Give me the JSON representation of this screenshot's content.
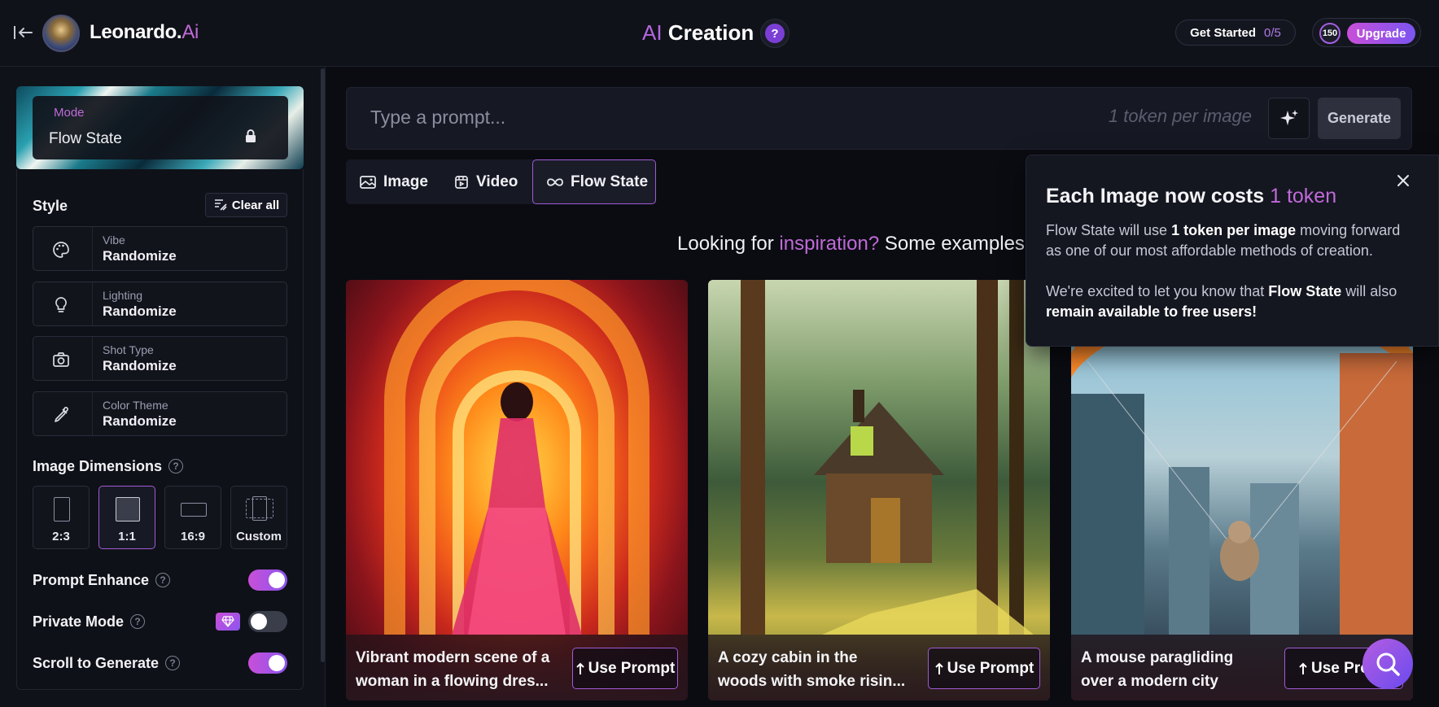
{
  "header": {
    "logo_main": "Leonardo.",
    "logo_accent": "Ai",
    "title_accent": "AI",
    "title_main": "Creation",
    "help_label": "?",
    "get_started_label": "Get Started",
    "get_started_count": "0/5",
    "token_count": "150",
    "upgrade_label": "Upgrade"
  },
  "sidebar": {
    "mode_label": "Mode",
    "mode_value": "Flow State",
    "style_title": "Style",
    "clear_all_label": "Clear all",
    "style_rows": [
      {
        "label": "Vibe",
        "value": "Randomize",
        "icon": "palette-icon"
      },
      {
        "label": "Lighting",
        "value": "Randomize",
        "icon": "lightbulb-icon"
      },
      {
        "label": "Shot Type",
        "value": "Randomize",
        "icon": "camera-icon"
      },
      {
        "label": "Color Theme",
        "value": "Randomize",
        "icon": "eyedropper-icon"
      }
    ],
    "dimensions_title": "Image Dimensions",
    "dimensions": [
      {
        "label": "2:3",
        "active": false
      },
      {
        "label": "1:1",
        "active": true
      },
      {
        "label": "16:9",
        "active": false
      },
      {
        "label": "Custom",
        "active": false
      }
    ],
    "toggles": [
      {
        "label": "Prompt Enhance",
        "on": true
      },
      {
        "label": "Private Mode",
        "on": false
      },
      {
        "label": "Scroll to Generate",
        "on": true
      }
    ]
  },
  "prompt": {
    "placeholder": "Type a prompt...",
    "token_hint": "1 token per image",
    "generate_label": "Generate"
  },
  "tabs": [
    {
      "label": "Image",
      "icon": "image-icon",
      "active": false
    },
    {
      "label": "Video",
      "icon": "video-icon",
      "active": false
    },
    {
      "label": "Flow State",
      "icon": "infinity-icon",
      "active": true
    }
  ],
  "inspiration": {
    "prefix": "Looking for",
    "highlight": "inspiration?",
    "suffix": "Some examples"
  },
  "cards": [
    {
      "line1": "Vibrant modern scene of a",
      "line2": "woman in a flowing dres...",
      "button": "Use Prompt"
    },
    {
      "line1": "A cozy cabin in the",
      "line2": "woods with smoke risin...",
      "button": "Use Prompt"
    },
    {
      "line1": "A mouse paragliding",
      "line2": "over a modern city",
      "button": "Use Pro"
    }
  ],
  "tooltip": {
    "title_prefix": "Each Image now costs",
    "title_highlight": "1 token",
    "p1_a": "Flow State will use",
    "p1_b": "1 token per image",
    "p1_c": "moving forward as one of our most affordable methods of creation.",
    "p2_a": "We're excited to let you know that",
    "p2_b": "Flow State",
    "p2_c": "will also",
    "p2_d": "remain available to free users!"
  },
  "colors": {
    "accent": "#c06ad8",
    "background": "#0b0c12",
    "panel": "#101219"
  }
}
